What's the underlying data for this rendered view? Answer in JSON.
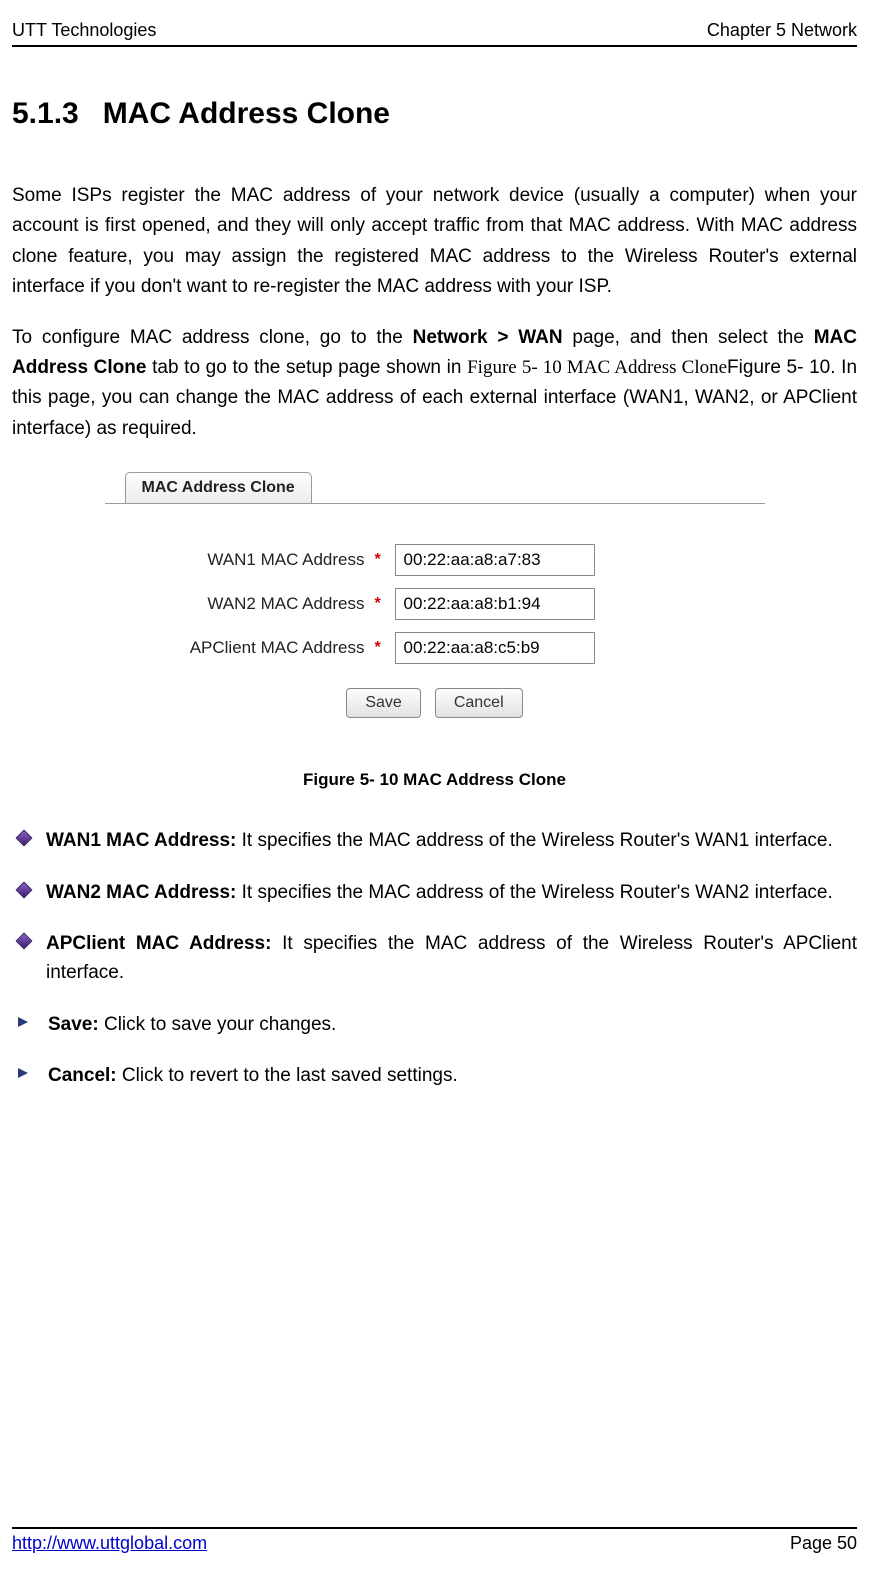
{
  "header": {
    "left": "UTT Technologies",
    "right": "Chapter 5 Network"
  },
  "section": {
    "number": "5.1.3",
    "title": "MAC Address Clone"
  },
  "paragraphs": {
    "p1": "Some ISPs register the MAC address of your network device (usually a computer) when your account is first opened, and they will only accept traffic from that MAC address. With MAC address clone feature, you may assign the registered MAC address to the Wireless Router's external interface if you don't want to re-register the MAC address with your ISP.",
    "p2_pre": "To configure MAC address clone, go to the ",
    "p2_bold1": "Network > WAN",
    "p2_mid1": " page, and then select the ",
    "p2_bold2": "MAC Address Clone",
    "p2_mid2": " tab to go to the setup page shown in ",
    "p2_figref": "Figure 5- 10 MAC Address Clone",
    "p2_post": "Figure 5- 10. In this page, you can change the MAC address of each external interface (WAN1, WAN2, or APClient interface) as required."
  },
  "figure": {
    "tab_label": "MAC Address Clone",
    "rows": [
      {
        "label": "WAN1 MAC Address",
        "value": "00:22:aa:a8:a7:83"
      },
      {
        "label": "WAN2 MAC Address",
        "value": "00:22:aa:a8:b1:94"
      },
      {
        "label": "APClient MAC Address",
        "value": "00:22:aa:a8:c5:b9"
      }
    ],
    "buttons": {
      "save": "Save",
      "cancel": "Cancel"
    },
    "caption": "Figure 5- 10 MAC Address Clone"
  },
  "bullets": [
    {
      "type": "diamond",
      "term": "WAN1 MAC Address:",
      "desc": " It specifies the MAC address of the Wireless Router's WAN1 interface."
    },
    {
      "type": "diamond",
      "term": "WAN2 MAC Address:",
      "desc": " It specifies the MAC address of the Wireless Router's WAN2 interface."
    },
    {
      "type": "diamond",
      "term": "APClient MAC Address:",
      "desc": " It specifies the MAC address of the Wireless Router's APClient interface."
    },
    {
      "type": "arrow",
      "term": "Save:",
      "desc": " Click to save your changes."
    },
    {
      "type": "arrow",
      "term": "Cancel:",
      "desc": " Click to revert to the last saved settings."
    }
  ],
  "footer": {
    "url": "http://www.uttglobal.com",
    "page": "Page 50"
  }
}
